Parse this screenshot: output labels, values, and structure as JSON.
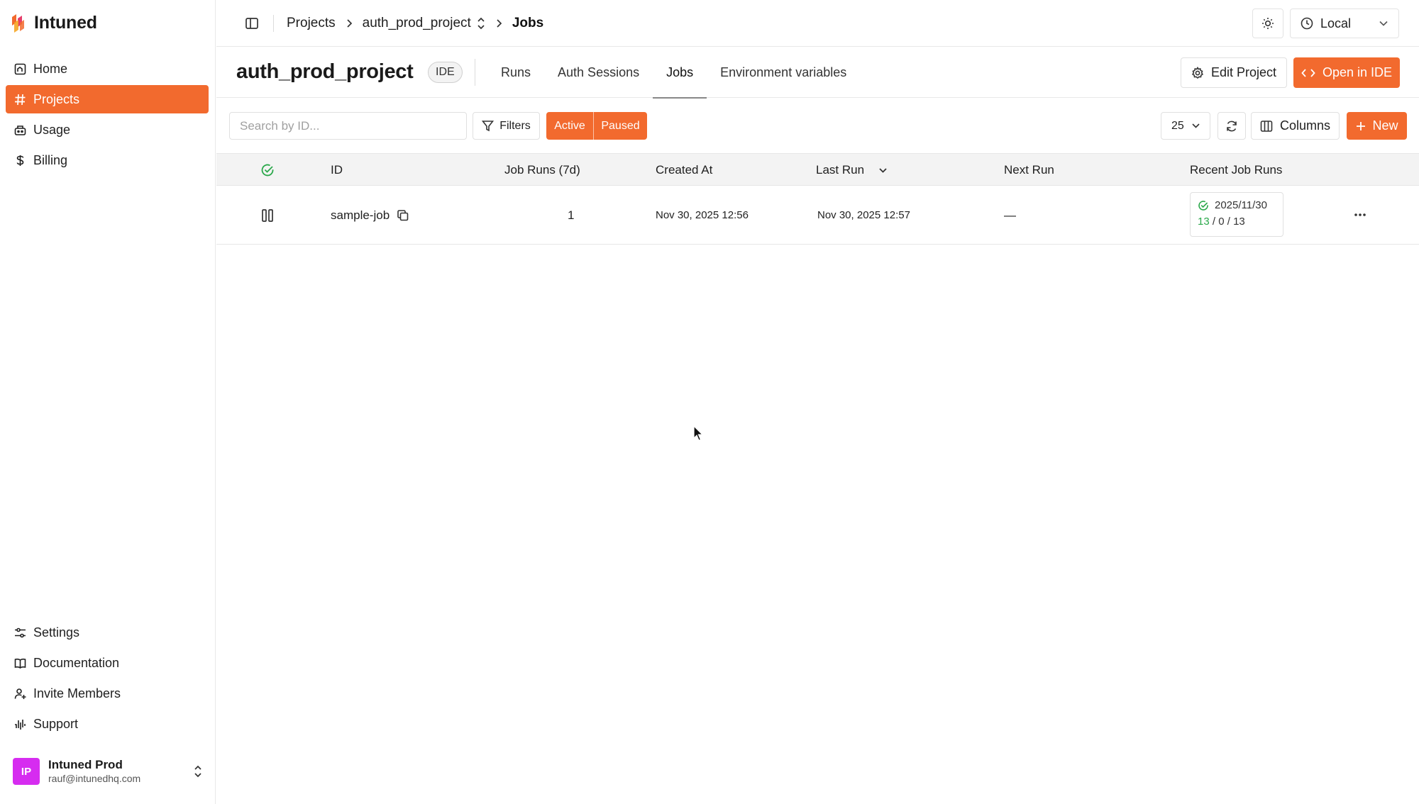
{
  "app": {
    "brand": "Intuned"
  },
  "sidebar": {
    "nav_top": [
      {
        "label": "Home",
        "icon": "home-icon"
      },
      {
        "label": "Projects",
        "icon": "hash-icon",
        "active": true
      },
      {
        "label": "Usage",
        "icon": "usage-icon"
      },
      {
        "label": "Billing",
        "icon": "dollar-icon"
      }
    ],
    "nav_bottom": [
      {
        "label": "Settings",
        "icon": "sliders-icon"
      },
      {
        "label": "Documentation",
        "icon": "book-icon"
      },
      {
        "label": "Invite Members",
        "icon": "user-plus-icon"
      },
      {
        "label": "Support",
        "icon": "support-icon"
      }
    ],
    "account": {
      "initials": "IP",
      "name": "Intuned Prod",
      "email": "rauf@intunedhq.com",
      "avatar_color": "#d62cf0"
    }
  },
  "topbar": {
    "breadcrumbs": [
      "Projects",
      "auth_prod_project",
      "Jobs"
    ],
    "environment": "Local"
  },
  "project": {
    "title": "auth_prod_project",
    "badge": "IDE",
    "tabs": [
      {
        "label": "Runs"
      },
      {
        "label": "Auth Sessions"
      },
      {
        "label": "Jobs",
        "active": true
      },
      {
        "label": "Environment variables"
      }
    ],
    "edit_label": "Edit Project",
    "open_ide_label": "Open in IDE"
  },
  "toolbar": {
    "search_placeholder": "Search by ID...",
    "filters_label": "Filters",
    "status_active": "Active",
    "status_paused": "Paused",
    "page_size": "25",
    "columns_label": "Columns",
    "new_label": "New"
  },
  "table": {
    "headers": {
      "id": "ID",
      "job_runs": "Job Runs (7d)",
      "created_at": "Created At",
      "last_run": "Last Run",
      "next_run": "Next Run",
      "recent_runs": "Recent Job Runs"
    },
    "rows": [
      {
        "id": "sample-job",
        "job_runs": "1",
        "created_at": "Nov 30, 2025 12:56",
        "last_run": "Nov 30, 2025 12:57",
        "next_run": "—",
        "recent": {
          "date": "2025/11/30",
          "success": "13",
          "sep1": "/",
          "failed": "0",
          "sep2": "/",
          "total": "13"
        }
      }
    ]
  },
  "colors": {
    "accent": "#f26a2e",
    "success": "#2aa84a"
  }
}
